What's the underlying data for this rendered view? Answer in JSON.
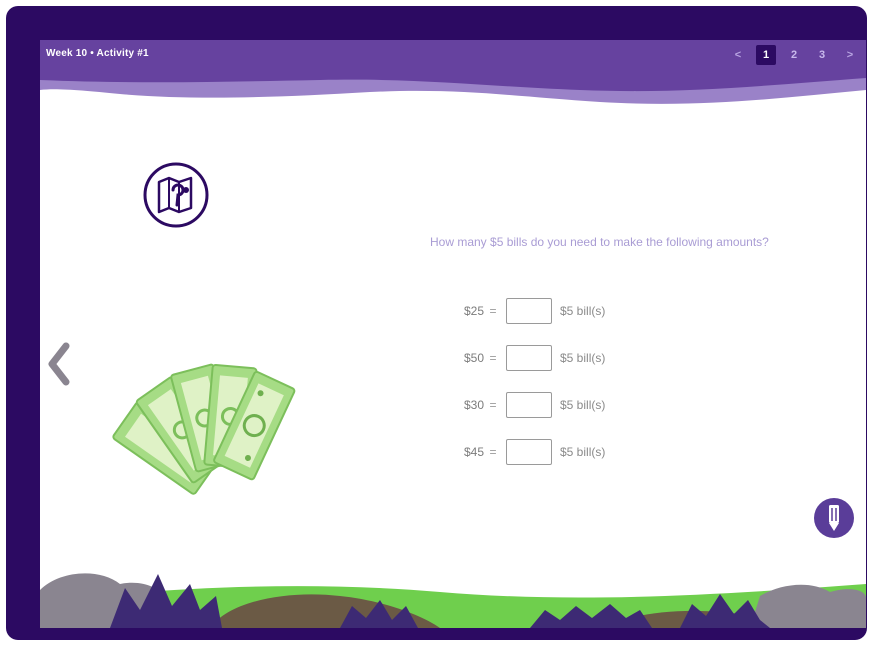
{
  "header": {
    "title": "Week 10 • Activity #1",
    "pager": {
      "prev_label": "<",
      "pages": [
        "1",
        "2",
        "3"
      ],
      "active_page": "1",
      "next_label": ">"
    }
  },
  "nav": {
    "back_icon": "chevron-left-icon"
  },
  "badge": {
    "icon": "map-pin-icon"
  },
  "illustration": {
    "icon": "dollar-bills-icon"
  },
  "question": {
    "text": "How many $5 bills do you need to make the following amounts?",
    "rows": [
      {
        "amount": "$25",
        "eq": "=",
        "unit": "$5 bill(s)"
      },
      {
        "amount": "$50",
        "eq": "=",
        "unit": "$5 bill(s)"
      },
      {
        "amount": "$30",
        "eq": "=",
        "unit": "$5 bill(s)"
      },
      {
        "amount": "$45",
        "eq": "=",
        "unit": "$5 bill(s)"
      }
    ]
  },
  "tools": {
    "pencil_icon": "pencil-icon"
  },
  "colors": {
    "frame": "#2c0a62",
    "header": "#66429f",
    "accent": "#5a3d99",
    "question_text": "#a99cd4",
    "bill_green": "#a6dc85",
    "grass": "#6fcf4d"
  }
}
